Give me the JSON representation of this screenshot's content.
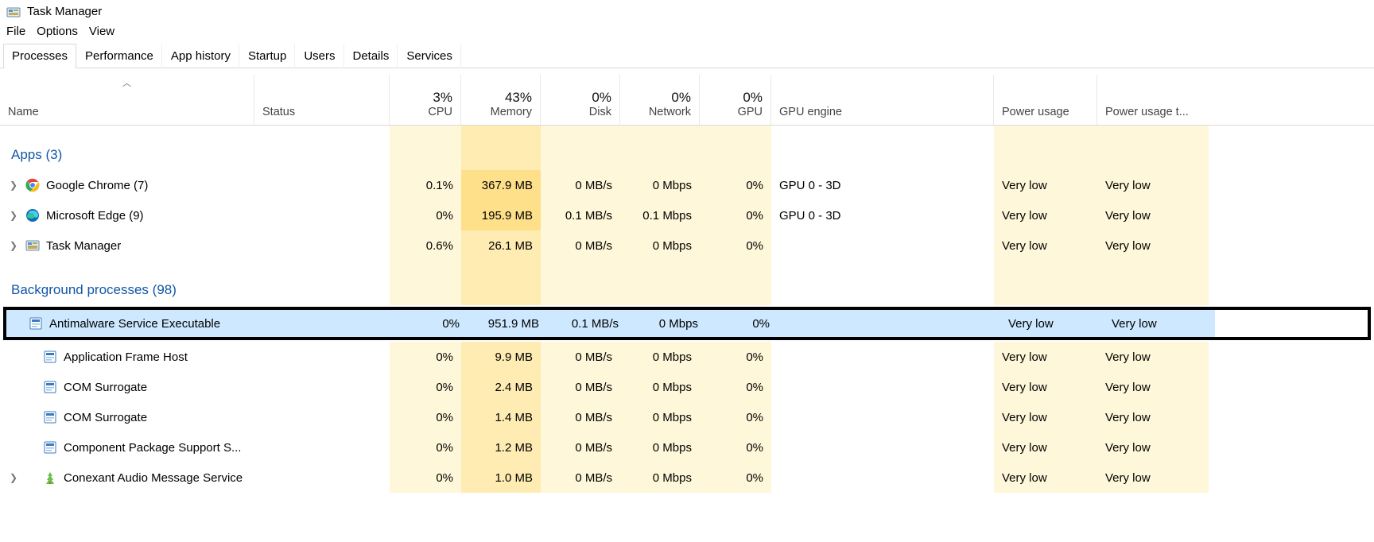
{
  "window": {
    "title": "Task Manager"
  },
  "menus": [
    "File",
    "Options",
    "View"
  ],
  "tabs": [
    "Processes",
    "Performance",
    "App history",
    "Startup",
    "Users",
    "Details",
    "Services"
  ],
  "activeTab": 0,
  "columns": {
    "name": "Name",
    "status": "Status",
    "cpu": {
      "metric": "3%",
      "label": "CPU"
    },
    "memory": {
      "metric": "43%",
      "label": "Memory"
    },
    "disk": {
      "metric": "0%",
      "label": "Disk"
    },
    "network": {
      "metric": "0%",
      "label": "Network"
    },
    "gpu": {
      "metric": "0%",
      "label": "GPU"
    },
    "gpuengine": "GPU engine",
    "power": "Power usage",
    "powertrend": "Power usage t..."
  },
  "groups": {
    "apps": "Apps (3)",
    "background": "Background processes (98)"
  },
  "apps": [
    {
      "icon": "chrome",
      "name": "Google Chrome (7)",
      "expandable": true,
      "cpu": "0.1%",
      "mem": "367.9 MB",
      "disk": "0 MB/s",
      "net": "0 Mbps",
      "gpu": "0%",
      "gpueng": "GPU 0 - 3D",
      "pow": "Very low",
      "powt": "Very low"
    },
    {
      "icon": "edge",
      "name": "Microsoft Edge (9)",
      "expandable": true,
      "cpu": "0%",
      "mem": "195.9 MB",
      "disk": "0.1 MB/s",
      "net": "0.1 Mbps",
      "gpu": "0%",
      "gpueng": "GPU 0 - 3D",
      "pow": "Very low",
      "powt": "Very low"
    },
    {
      "icon": "taskmgr",
      "name": "Task Manager",
      "expandable": true,
      "cpu": "0.6%",
      "mem": "26.1 MB",
      "disk": "0 MB/s",
      "net": "0 Mbps",
      "gpu": "0%",
      "gpueng": "",
      "pow": "Very low",
      "powt": "Very low"
    }
  ],
  "highlighted": {
    "icon": "generic",
    "name": "Antimalware Service Executable",
    "expandable": false,
    "cpu": "0%",
    "mem": "951.9 MB",
    "disk": "0.1 MB/s",
    "net": "0 Mbps",
    "gpu": "0%",
    "gpueng": "",
    "pow": "Very low",
    "powt": "Very low"
  },
  "background": [
    {
      "icon": "generic",
      "name": "Application Frame Host",
      "expandable": false,
      "cpu": "0%",
      "mem": "9.9 MB",
      "disk": "0 MB/s",
      "net": "0 Mbps",
      "gpu": "0%",
      "gpueng": "",
      "pow": "Very low",
      "powt": "Very low"
    },
    {
      "icon": "generic",
      "name": "COM Surrogate",
      "expandable": false,
      "cpu": "0%",
      "mem": "2.4 MB",
      "disk": "0 MB/s",
      "net": "0 Mbps",
      "gpu": "0%",
      "gpueng": "",
      "pow": "Very low",
      "powt": "Very low"
    },
    {
      "icon": "generic",
      "name": "COM Surrogate",
      "expandable": false,
      "cpu": "0%",
      "mem": "1.4 MB",
      "disk": "0 MB/s",
      "net": "0 Mbps",
      "gpu": "0%",
      "gpueng": "",
      "pow": "Very low",
      "powt": "Very low"
    },
    {
      "icon": "generic",
      "name": "Component Package Support S...",
      "expandable": false,
      "cpu": "0%",
      "mem": "1.2 MB",
      "disk": "0 MB/s",
      "net": "0 Mbps",
      "gpu": "0%",
      "gpueng": "",
      "pow": "Very low",
      "powt": "Very low"
    },
    {
      "icon": "conexant",
      "name": "Conexant Audio Message Service",
      "expandable": true,
      "cpu": "0%",
      "mem": "1.0 MB",
      "disk": "0 MB/s",
      "net": "0 Mbps",
      "gpu": "0%",
      "gpueng": "",
      "pow": "Very low",
      "powt": "Very low"
    }
  ]
}
